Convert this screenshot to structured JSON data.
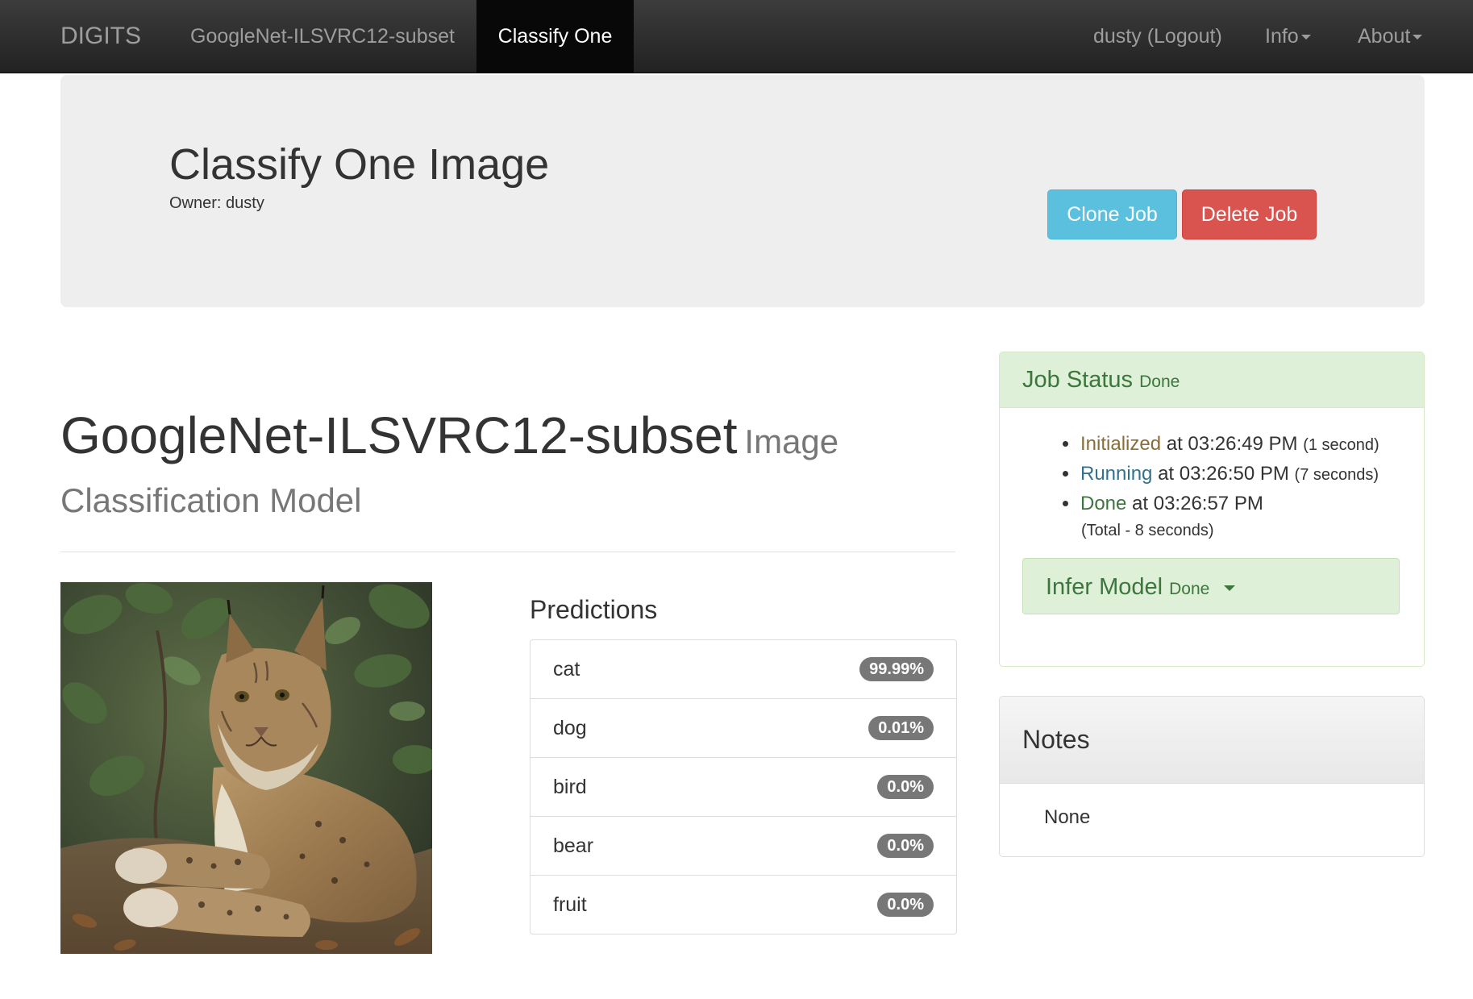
{
  "navbar": {
    "brand": "DIGITS",
    "model_link": "GoogleNet-ILSVRC12-subset",
    "active_tab": "Classify One",
    "user": "dusty (Logout)",
    "info": "Info",
    "about": "About"
  },
  "header": {
    "title": "Classify One Image",
    "owner": "Owner: dusty",
    "clone_label": "Clone Job",
    "delete_label": "Delete Job"
  },
  "model": {
    "name": "GoogleNet-ILSVRC12-subset",
    "subtitle": "Image Classification Model"
  },
  "predictions": {
    "heading": "Predictions",
    "items": [
      {
        "label": "cat",
        "value": "99.99%"
      },
      {
        "label": "dog",
        "value": "0.01%"
      },
      {
        "label": "bird",
        "value": "0.0%"
      },
      {
        "label": "bear",
        "value": "0.0%"
      },
      {
        "label": "fruit",
        "value": "0.0%"
      }
    ]
  },
  "job_status": {
    "title": "Job Status",
    "state": "Done",
    "events": [
      {
        "status": "Initialized",
        "time": "at 03:26:49 PM",
        "duration": "(1 second)"
      },
      {
        "status": "Running",
        "time": "at 03:26:50 PM",
        "duration": "(7 seconds)"
      },
      {
        "status": "Done",
        "time": "at 03:26:57 PM",
        "duration": ""
      }
    ],
    "total": "(Total - 8 seconds)",
    "infer_label": "Infer Model",
    "infer_state": "Done"
  },
  "notes": {
    "title": "Notes",
    "body": "None"
  },
  "colors": {
    "navbar": "#222222",
    "clone_button": "#5bc0de",
    "delete_button": "#d9534f",
    "success_bg": "#dff0d8",
    "success_text": "#3c763d",
    "badge": "#777777"
  }
}
